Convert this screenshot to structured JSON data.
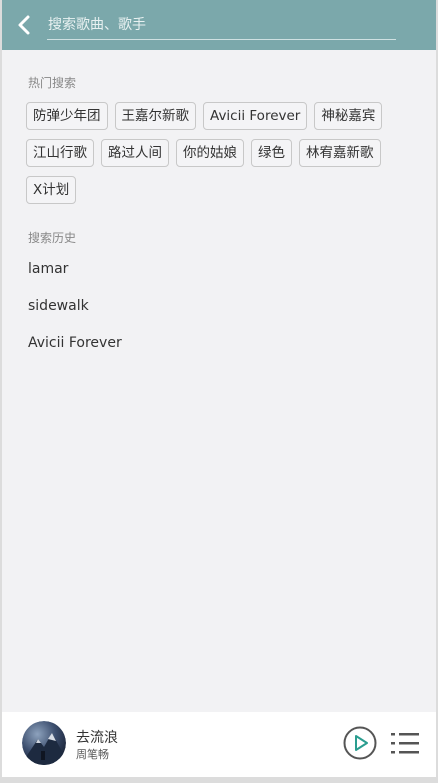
{
  "search": {
    "placeholder": "搜索歌曲、歌手",
    "value": ""
  },
  "hot": {
    "title": "热门搜索",
    "tags": [
      "防弹少年团",
      "王嘉尔新歌",
      "Avicii Forever",
      "神秘嘉宾",
      "江山行歌",
      "路过人间",
      "你的姑娘",
      "绿色",
      "林宥嘉新歌",
      "X计划"
    ]
  },
  "history": {
    "title": "搜索历史",
    "items": [
      "lamar",
      "sidewalk",
      "Avicii Forever"
    ]
  },
  "player": {
    "song_title": "去流浪",
    "artist": "周笔畅",
    "accent_color": "#2a9d8f"
  },
  "colors": {
    "header_bg": "#7ba8ab",
    "page_bg": "#f2f2f4"
  },
  "icons": {
    "back": "chevron-left-icon",
    "play": "play-circle-icon",
    "playlist": "playlist-icon"
  }
}
